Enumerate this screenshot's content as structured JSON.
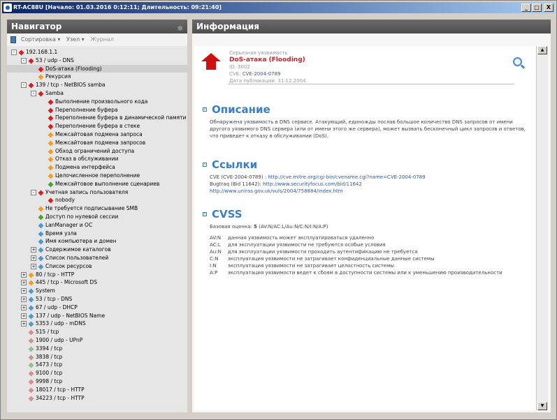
{
  "window": {
    "title": "RT-AC88U [Начало: 01.03.2016 0:12:11; Длительность: 09:21:40]",
    "min": "_",
    "max": "□",
    "close": "X"
  },
  "nav": {
    "title": "Навигатор",
    "sort": "Сортировка ▾",
    "node": "Узел ▾",
    "journal": "Журнал"
  },
  "tree": [
    {
      "label": "192.168.1.1",
      "icon": "host-icon",
      "color": "#d42020",
      "expander": "-"
    },
    {
      "label": "53 / udp - DNS",
      "icon": "port-icon",
      "color": "#d42020",
      "expander": "-"
    },
    {
      "label": "DoS-атака (Flooding)",
      "icon": "vuln-icon",
      "color": "#d42020",
      "expander": ""
    },
    {
      "label": "Рекурсия",
      "icon": "vuln-icon",
      "color": "#f0a020",
      "expander": ""
    },
    {
      "label": "139 / tcp - NetBIOS samba",
      "icon": "port-icon",
      "color": "#d42020",
      "expander": "-"
    },
    {
      "label": "Samba",
      "icon": "service-icon",
      "color": "#d42020",
      "expander": "-"
    },
    {
      "label": "Выполнение произвольного кода",
      "icon": "vuln-icon",
      "color": "#d42020",
      "expander": ""
    },
    {
      "label": "Переполнение буфера",
      "icon": "vuln-icon",
      "color": "#d42020",
      "expander": ""
    },
    {
      "label": "Переполнение буфера в динамической памяти",
      "icon": "vuln-icon",
      "color": "#d42020",
      "expander": ""
    },
    {
      "label": "Переполнение буфера в стеке",
      "icon": "vuln-icon",
      "color": "#d42020",
      "expander": ""
    },
    {
      "label": "Межсайтовая подмена запроса",
      "icon": "vuln-icon",
      "color": "#f0a020",
      "expander": ""
    },
    {
      "label": "Межсайтовая подмена запросов",
      "icon": "vuln-icon",
      "color": "#f0a020",
      "expander": ""
    },
    {
      "label": "Обход ограничений доступа",
      "icon": "vuln-icon",
      "color": "#f0a020",
      "expander": ""
    },
    {
      "label": "Отказ в обслуживании",
      "icon": "vuln-icon",
      "color": "#f0a020",
      "expander": ""
    },
    {
      "label": "Подмена интерфейса",
      "icon": "vuln-icon",
      "color": "#f0a020",
      "expander": ""
    },
    {
      "label": "Целочисленное переполнение",
      "icon": "vuln-icon",
      "color": "#f0a020",
      "expander": ""
    },
    {
      "label": "Межсайтовое выполнение сценариев",
      "icon": "vuln-icon",
      "color": "#50a030",
      "expander": ""
    },
    {
      "label": "Учетная запись пользователя",
      "icon": "vuln-icon",
      "color": "#d42020",
      "expander": "-"
    },
    {
      "label": "nobody",
      "icon": "vuln-icon",
      "color": "#d42020",
      "expander": ""
    },
    {
      "label": "Не требуется подписывание SMB",
      "icon": "vuln-icon",
      "color": "#f0a020",
      "expander": ""
    },
    {
      "label": "Доступ по нулевой сессии",
      "icon": "vuln-icon",
      "color": "#50a030",
      "expander": ""
    },
    {
      "label": "LanManager и ОС",
      "icon": "info-icon",
      "color": "#4a9ad8",
      "expander": ""
    },
    {
      "label": "Время узла",
      "icon": "info-icon",
      "color": "#4a9ad8",
      "expander": ""
    },
    {
      "label": "Имя компьютера и домен",
      "icon": "info-icon",
      "color": "#4a9ad8",
      "expander": ""
    },
    {
      "label": "Содержимое каталогов",
      "icon": "info-icon",
      "color": "#4a9ad8",
      "expander": "+"
    },
    {
      "label": "Список пользователей",
      "icon": "info-icon",
      "color": "#4a9ad8",
      "expander": "+"
    },
    {
      "label": "Список ресурсов",
      "icon": "info-icon",
      "color": "#4a9ad8",
      "expander": "+"
    },
    {
      "label": "80 / tcp - HTTP",
      "icon": "port-icon",
      "color": "#f0a020",
      "expander": "+"
    },
    {
      "label": "445 / tcp - Microsoft DS",
      "icon": "port-icon",
      "color": "#f0a020",
      "expander": "+"
    },
    {
      "label": "System",
      "icon": "port-icon",
      "color": "#4a9ad8",
      "expander": "+"
    },
    {
      "label": "53 / tcp - DNS",
      "icon": "port-icon",
      "color": "#4a9ad8",
      "expander": "+"
    },
    {
      "label": "67 / udp - DHCP",
      "icon": "port-icon",
      "color": "#4a9ad8",
      "expander": "+"
    },
    {
      "label": "137 / udp - NetBIOS Name",
      "icon": "port-icon",
      "color": "#4a9ad8",
      "expander": "+"
    },
    {
      "label": "5353 / udp - mDNS",
      "icon": "port-icon",
      "color": "#4a9ad8",
      "expander": "+"
    },
    {
      "label": "515 / tcp",
      "icon": "port-icon",
      "color": "#d49090",
      "expander": ""
    },
    {
      "label": "1900 / udp - UPnP",
      "icon": "port-icon",
      "color": "#d49090",
      "expander": ""
    },
    {
      "label": "3394 / tcp",
      "icon": "port-icon",
      "color": "#90c090",
      "expander": ""
    },
    {
      "label": "3838 / tcp",
      "icon": "port-icon",
      "color": "#d49090",
      "expander": ""
    },
    {
      "label": "5473 / tcp",
      "icon": "port-icon",
      "color": "#90c090",
      "expander": ""
    },
    {
      "label": "9100 / tcp",
      "icon": "port-icon",
      "color": "#d49090",
      "expander": ""
    },
    {
      "label": "9998 / tcp",
      "icon": "port-icon",
      "color": "#d49090",
      "expander": ""
    },
    {
      "label": "18017 / tcp - HTTP",
      "icon": "port-icon",
      "color": "#d49090",
      "expander": ""
    },
    {
      "label": "34223 / tcp - HTTP",
      "icon": "port-icon",
      "color": "#d49090",
      "expander": ""
    }
  ],
  "info": {
    "title": "Информация",
    "severity": "Серьезная уязвимость",
    "vuln_name": "DoS-атака (Flooding)",
    "id": "ID: 3002",
    "cve_label": "CVE:",
    "cve": "CVE-2004-0789",
    "pub": "Дата публикации: 31.12.2004",
    "desc_title": "Описание",
    "desc": "Обнаружена уязвимость в DNS сервисе. Атакующий, единожды послав большое количество DNS запросов от имени другого уязвимого DNS сервера (или от имени этого же сервера), может вызвать бесконечный цикл запросов и ответов, что приведет к отказу в обслуживании (DoS).",
    "links_title": "Ссылки",
    "link1_prefix": "CVE (CVE-2004-0789) : ",
    "link1": "http://cve.mitre.org/cgi-bin/cvename.cgi?name=CVE-2004-0789",
    "link2_prefix": "Bugtraq (Bid 11642): ",
    "link2": "http://www.securityfocus.com/bid/11642",
    "link3": "http://www.uniras.gov.uk/vuls/2004/758884/index.htm",
    "cvss_title": "CVSS",
    "cvss_base_prefix": "Базовая оценка: ",
    "cvss_score": "5",
    "cvss_vector": " (AV:N/AC:L/Au:N/C:N/I:N/A:P)",
    "cvss_rows": [
      {
        "k": "AV:N",
        "v": "данная уязвимость может эксплуатироваться удаленно"
      },
      {
        "k": "AC:L",
        "v": "для эксплуатации уязвимости не требуются особые условия"
      },
      {
        "k": "Au:N",
        "v": "для эксплуатации уязвимости проходить аутентификацию не требуется"
      },
      {
        "k": "C:N",
        "v": "эксплуатация уязвимости не затрагивает конфиденциальные данные системы"
      },
      {
        "k": "I:N",
        "v": "эксплуатация уязвимости не затрагивает целостность системы"
      },
      {
        "k": "A:P",
        "v": "эксплуатация уязвимости ведет к сбоям в доступности системы или к уменьшению производительности"
      }
    ]
  }
}
